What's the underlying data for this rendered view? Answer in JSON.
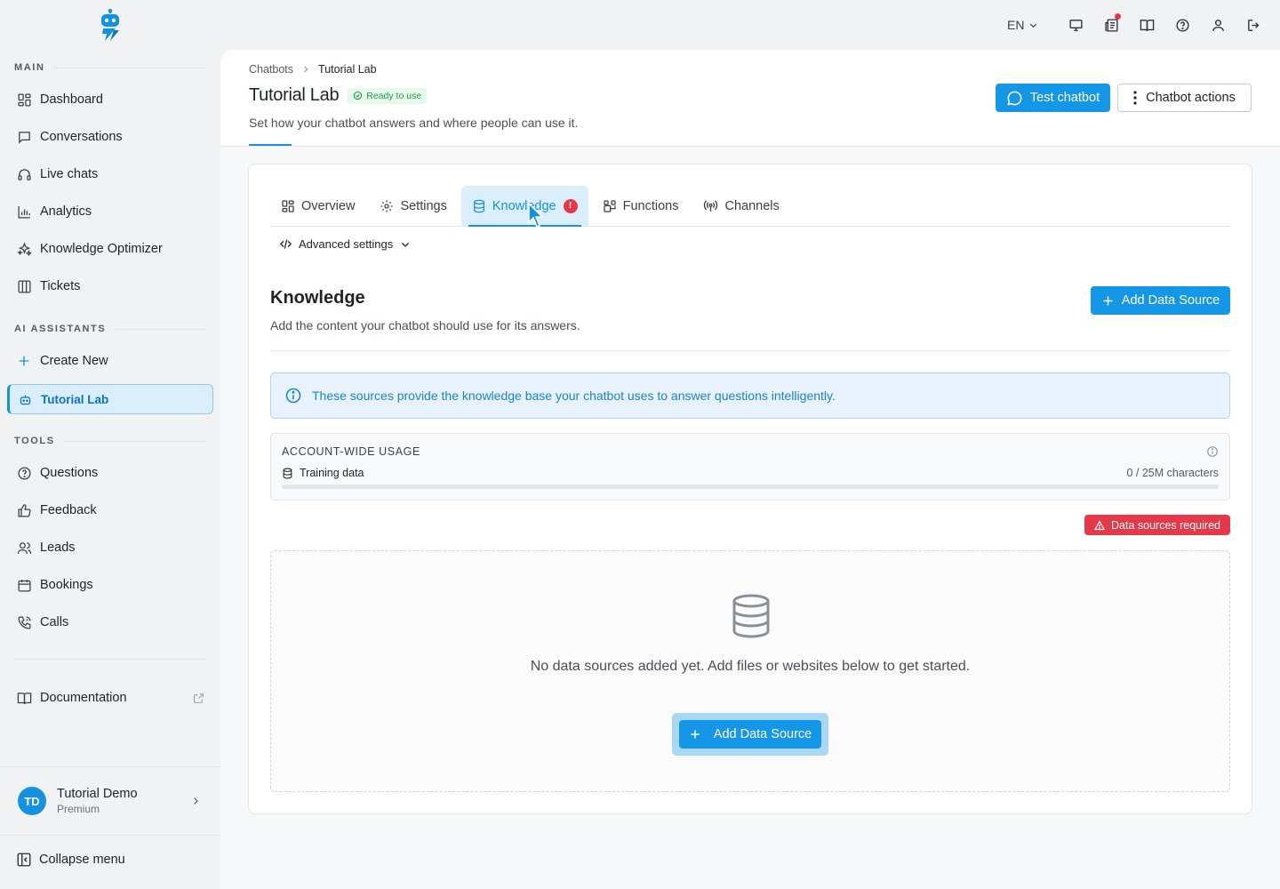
{
  "sidebar": {
    "sections": {
      "main": "MAIN",
      "ai": "AI ASSISTANTS",
      "tools": "TOOLS"
    },
    "main_items": [
      {
        "label": "Dashboard",
        "icon": "dashboard-icon"
      },
      {
        "label": "Conversations",
        "icon": "chat-icon"
      },
      {
        "label": "Live chats",
        "icon": "headset-icon"
      },
      {
        "label": "Analytics",
        "icon": "bar-chart-icon"
      },
      {
        "label": "Knowledge Optimizer",
        "icon": "sparkles-icon"
      },
      {
        "label": "Tickets",
        "icon": "columns-icon"
      }
    ],
    "ai_items": [
      {
        "label": "Create New",
        "icon": "plus-icon"
      },
      {
        "label": "Tutorial Lab",
        "icon": "bot-icon",
        "active": true
      }
    ],
    "tool_items": [
      {
        "label": "Questions",
        "icon": "question-icon"
      },
      {
        "label": "Feedback",
        "icon": "thumbs-up-icon"
      },
      {
        "label": "Leads",
        "icon": "users-icon"
      },
      {
        "label": "Bookings",
        "icon": "calendar-icon"
      },
      {
        "label": "Calls",
        "icon": "phone-icon"
      }
    ],
    "documentation": "Documentation",
    "user": {
      "initials": "TD",
      "name": "Tutorial Demo",
      "plan": "Premium"
    },
    "collapse": "Collapse menu"
  },
  "topbar": {
    "language": "EN"
  },
  "header": {
    "breadcrumb": [
      "Chatbots",
      "Tutorial Lab"
    ],
    "title": "Tutorial Lab",
    "status": "Ready to use",
    "subtitle": "Set how your chatbot answers and where people can use it.",
    "test_button": "Test chatbot",
    "actions_button": "Chatbot actions"
  },
  "tabs": [
    {
      "label": "Overview",
      "icon": "grid-icon"
    },
    {
      "label": "Settings",
      "icon": "gear-icon"
    },
    {
      "label": "Knowledge",
      "icon": "database-icon",
      "active": true,
      "alert": "!"
    },
    {
      "label": "Functions",
      "icon": "blocks-icon"
    },
    {
      "label": "Channels",
      "icon": "broadcast-icon"
    }
  ],
  "advanced_settings": "Advanced settings",
  "knowledge": {
    "title": "Knowledge",
    "subtitle": "Add the content your chatbot should use for its answers.",
    "add_button": "Add Data Source",
    "info": "These sources provide the knowledge base your chatbot uses to answer questions intelligently.",
    "usage": {
      "title": "ACCOUNT-WIDE USAGE",
      "row_label": "Training data",
      "count": "0 / 25M characters",
      "fill_fraction": 0
    },
    "error_badge": "Data sources required",
    "empty_text": "No data sources added yet. Add files or websites below to get started.",
    "empty_button": "Add Data Source"
  },
  "colors": {
    "accent": "#1497e6",
    "danger": "#e5394a",
    "success": "#1e9e4a"
  }
}
